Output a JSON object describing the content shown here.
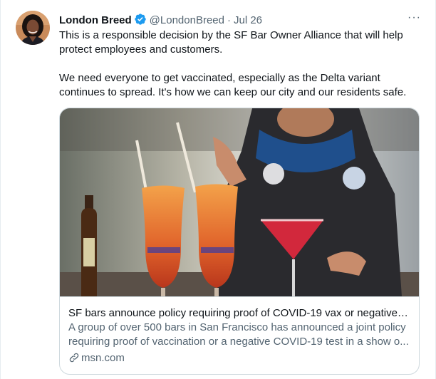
{
  "author": {
    "name": "London Breed",
    "handle": "@LondonBreed",
    "separator": "·",
    "time": "Jul 26"
  },
  "more_menu": "···",
  "tweet": {
    "paragraph_1": "This is a responsible decision by the SF Bar Owner Alliance that will help protect employees and customers.",
    "paragraph_2": "We need everyone to get vaccinated, especially as the Delta variant continues to spread. It's how we can keep our city and our residents safe."
  },
  "link_card": {
    "title": "SF bars announce policy requiring proof of COVID-19 vax or negative t...",
    "description": "A group of over 500 bars in San Francisco has announced a joint policy requiring proof of vaccination or a negative COVID-19 test in a show o...",
    "domain": "msn.com"
  },
  "icons": {
    "verified": "verified-badge-icon",
    "link": "link-icon",
    "more": "more-options-icon"
  },
  "colors": {
    "text_primary": "#0f1419",
    "text_secondary": "#536471",
    "verified_blue": "#1d9bf0",
    "border": "#cfd9de"
  }
}
